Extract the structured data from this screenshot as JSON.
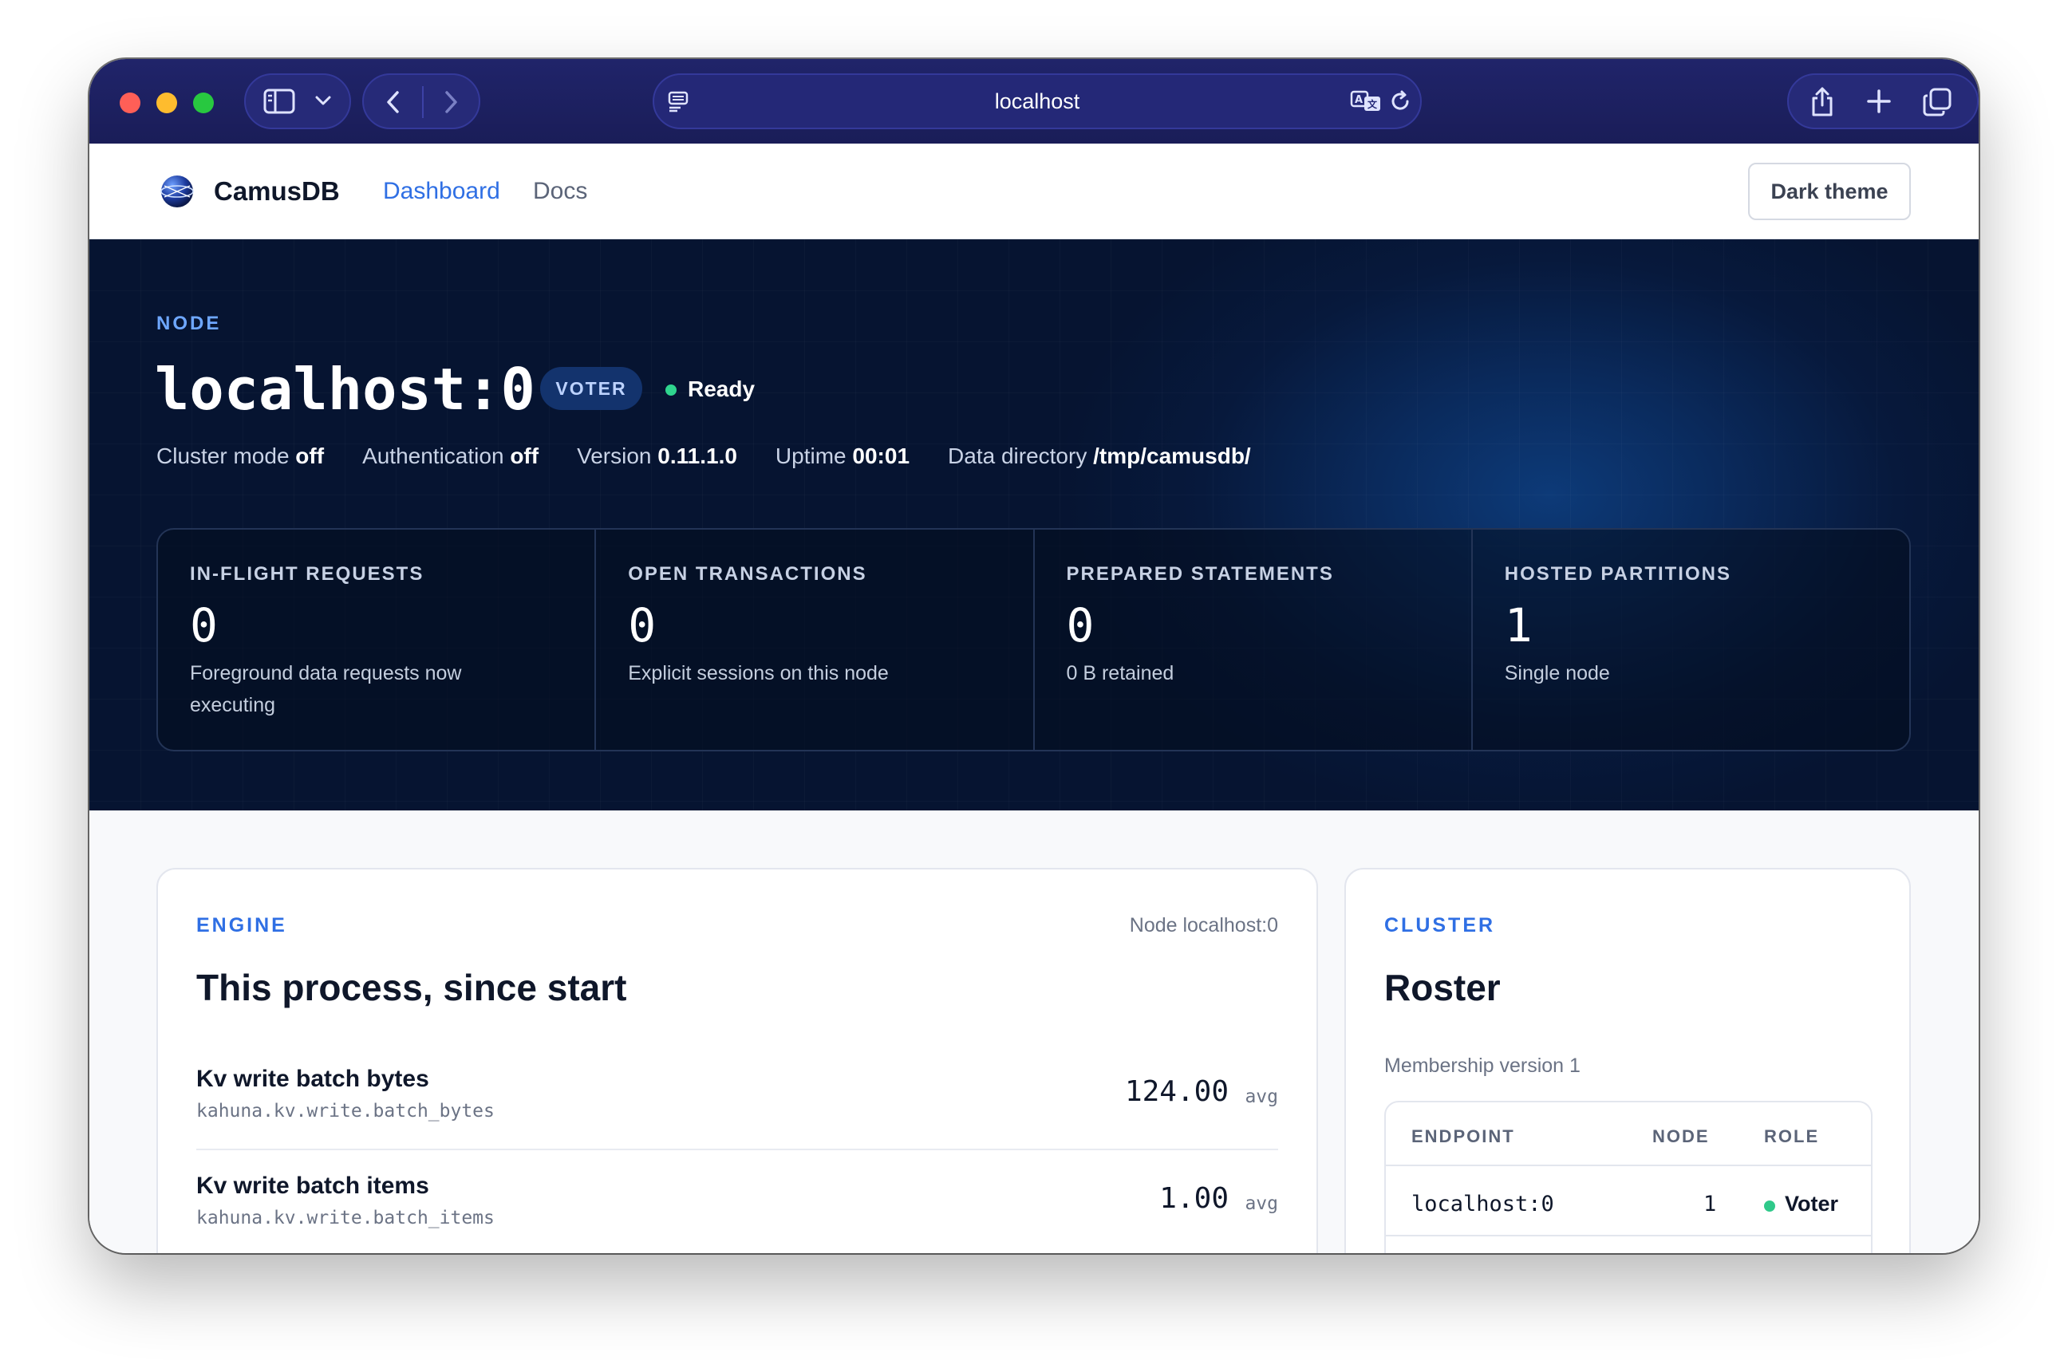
{
  "browser": {
    "address": "localhost"
  },
  "nav": {
    "brand": "CamusDB",
    "links": [
      "Dashboard",
      "Docs"
    ],
    "theme_button": "Dark theme"
  },
  "hero": {
    "eyebrow": "NODE",
    "title": "localhost:0",
    "badge": "VOTER",
    "status": "Ready",
    "meta": [
      {
        "label": "Cluster mode",
        "value": "off"
      },
      {
        "label": "Authentication",
        "value": "off"
      },
      {
        "label": "Version",
        "value": "0.11.1.0"
      },
      {
        "label": "Uptime",
        "value": "00:01"
      },
      {
        "label": "Data directory",
        "value": "/tmp/camusdb/"
      }
    ],
    "stats": [
      {
        "label": "IN-FLIGHT REQUESTS",
        "value": "0",
        "note": "Foreground data requests now executing"
      },
      {
        "label": "OPEN TRANSACTIONS",
        "value": "0",
        "note": "Explicit sessions on this node"
      },
      {
        "label": "PREPARED STATEMENTS",
        "value": "0",
        "note": "0 B retained"
      },
      {
        "label": "HOSTED PARTITIONS",
        "value": "1",
        "note": "Single node"
      }
    ]
  },
  "engine": {
    "eyebrow": "ENGINE",
    "meta": "Node localhost:0",
    "title": "This process, since start",
    "metrics": [
      {
        "name": "Kv write batch bytes",
        "key": "kahuna.kv.write.batch_bytes",
        "value": "124.00",
        "unit": "avg"
      },
      {
        "name": "Kv write batch items",
        "key": "kahuna.kv.write.batch_items",
        "value": "1.00",
        "unit": "avg"
      }
    ]
  },
  "cluster": {
    "eyebrow": "CLUSTER",
    "title": "Roster",
    "membership": "Membership version 1",
    "columns": [
      "ENDPOINT",
      "NODE",
      "ROLE"
    ],
    "rows": [
      {
        "endpoint": "localhost:0",
        "node": "1",
        "role": "Voter"
      }
    ]
  },
  "colors": {
    "accent": "#2f6fe4",
    "status_ok": "#2fd58e",
    "chrome": "#1c1f5c",
    "hero": "#07193c"
  }
}
